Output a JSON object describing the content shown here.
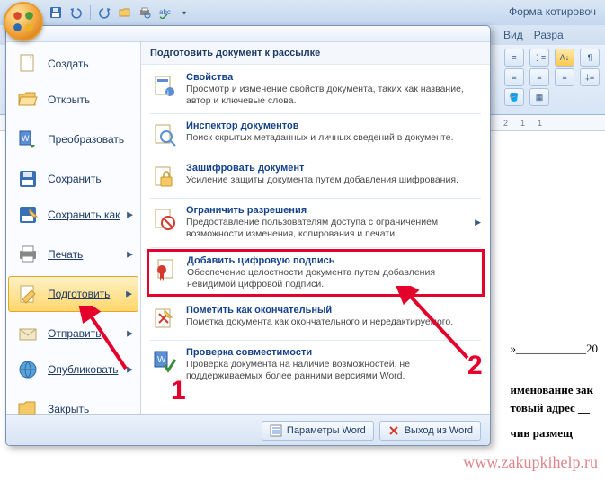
{
  "title": "Форма котировоч",
  "qat": {
    "items": [
      "save",
      "undo",
      "redo",
      "open",
      "print-preview",
      "spellcheck"
    ]
  },
  "ribbon_tabs": [
    "Вид",
    "Разра"
  ],
  "ruler_marks": [
    "2",
    "1",
    "",
    "1"
  ],
  "menu": {
    "left": [
      {
        "label": "Создать",
        "icon": "new"
      },
      {
        "label": "Открыть",
        "icon": "open"
      },
      {
        "label": "Преобразовать",
        "icon": "convert"
      },
      {
        "label": "Сохранить",
        "icon": "save"
      },
      {
        "label": "Сохранить как",
        "icon": "saveas",
        "arrow": true
      },
      {
        "label": "Печать",
        "icon": "print",
        "arrow": true
      },
      {
        "label": "Подготовить",
        "icon": "prepare",
        "arrow": true,
        "active": true
      },
      {
        "label": "Отправить",
        "icon": "send",
        "arrow": true
      },
      {
        "label": "Опубликовать",
        "icon": "publish",
        "arrow": true
      },
      {
        "label": "Закрыть",
        "icon": "close"
      }
    ],
    "right_header": "Подготовить документ к рассылке",
    "right_items": [
      {
        "title": "Свойства",
        "desc": "Просмотр и изменение свойств документа, таких как название, автор и ключевые слова.",
        "icon": "props"
      },
      {
        "title": "Инспектор документов",
        "desc": "Поиск скрытых метаданных и личных сведений в документе.",
        "icon": "inspect"
      },
      {
        "title": "Зашифровать документ",
        "desc": "Усиление защиты документа путем добавления шифрования.",
        "icon": "encrypt"
      },
      {
        "title": "Ограничить разрешения",
        "desc": "Предоставление пользователям доступа с ограничением возможности изменения, копирования и печати.",
        "icon": "restrict",
        "arrow": true
      },
      {
        "title": "Добавить цифровую подпись",
        "desc": "Обеспечение целостности документа путем добавления невидимой цифровой подписи.",
        "icon": "sign",
        "highlight": true
      },
      {
        "title": "Пометить как окончательный",
        "desc": "Пометка документа как окончательного и нередактируемого.",
        "icon": "final"
      },
      {
        "title": "Проверка совместимости",
        "desc": "Проверка документа на наличие возможностей, не поддерживаемых более ранними версиями Word.",
        "icon": "compat"
      }
    ],
    "bottom": {
      "options": "Параметры Word",
      "exit": "Выход из Word"
    }
  },
  "annotations": {
    "num1": "1",
    "num2": "2"
  },
  "doc": {
    "line1": "»____________20",
    "line2": "именование зак",
    "line3": "товый адрес __",
    "line4": "чив размещ"
  },
  "watermark": "www.zakupkihelp.ru"
}
